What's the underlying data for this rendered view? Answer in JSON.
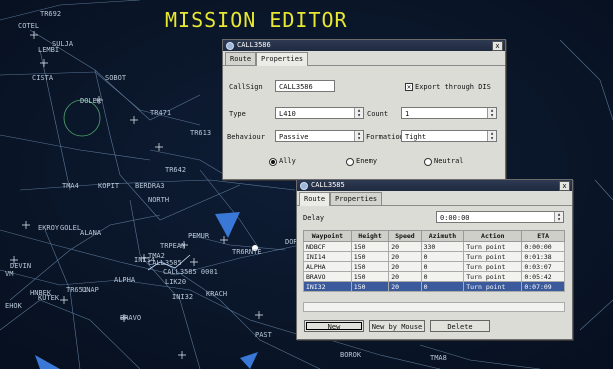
{
  "title": "MISSION EDITOR",
  "map": {
    "labels": [
      "TR692",
      "COTEL",
      "LEMBI",
      "SULJA",
      "CISTA",
      "SOBOT",
      "DOLEK",
      "TR471",
      "TR613",
      "TR642",
      "TMA4",
      "KOPIT",
      "BERDRA3",
      "NORTH",
      "EKROY",
      "GOLEL",
      "ALANA",
      "PEMUR",
      "DEVIN",
      "VM",
      "KUTEK",
      "UNAP",
      "TR651",
      "BRAVO",
      "INI14",
      "TMA2",
      "CALL3585",
      "CALL3585 0001",
      "LIK20",
      "INI32",
      "KRACH",
      "ALPHA",
      "TR6RNTE",
      "PAST",
      "BOROK",
      "TMA8",
      "DOR",
      "TRPEAN",
      "HNBEK",
      "EHOK"
    ]
  },
  "dialog1": {
    "title": "CALL3586",
    "close": "x",
    "tabs": [
      "Route",
      "Properties"
    ],
    "callsign_label": "CallSign",
    "callsign_value": "CALL3586",
    "export_label": "Export through DIS",
    "export_checked": true,
    "type_label": "Type",
    "type_value": "L410",
    "count_label": "Count",
    "count_value": "1",
    "behaviour_label": "Behaviour",
    "behaviour_value": "Passive",
    "formation_label": "Formation",
    "formation_value": "Tight",
    "radio": [
      "Ally",
      "Enemy",
      "Neutral"
    ],
    "radio_selected": "Ally"
  },
  "dialog2": {
    "title": "CALL3585",
    "close": "x",
    "tabs": [
      "Route",
      "Properties"
    ],
    "delay_label": "Delay",
    "delay_value": "0:00:00",
    "columns": [
      "Waypoint",
      "Height",
      "Speed",
      "Azimuth",
      "Action",
      "ETA"
    ],
    "rows": [
      [
        "NDBCF",
        "150",
        "20",
        "330",
        "Turn point",
        "0:00:00"
      ],
      [
        "INI14",
        "150",
        "20",
        "0",
        "Turn point",
        "0:01:38"
      ],
      [
        "ALPHA",
        "150",
        "20",
        "0",
        "Turn point",
        "0:03:07"
      ],
      [
        "BRAVO",
        "150",
        "20",
        "0",
        "Turn point",
        "0:05:42"
      ],
      [
        "INI32",
        "150",
        "20",
        "0",
        "Turn point",
        "0:07:09"
      ]
    ],
    "selected_row": 4,
    "buttons": [
      "New",
      "New by Mouse",
      "Delete"
    ]
  }
}
